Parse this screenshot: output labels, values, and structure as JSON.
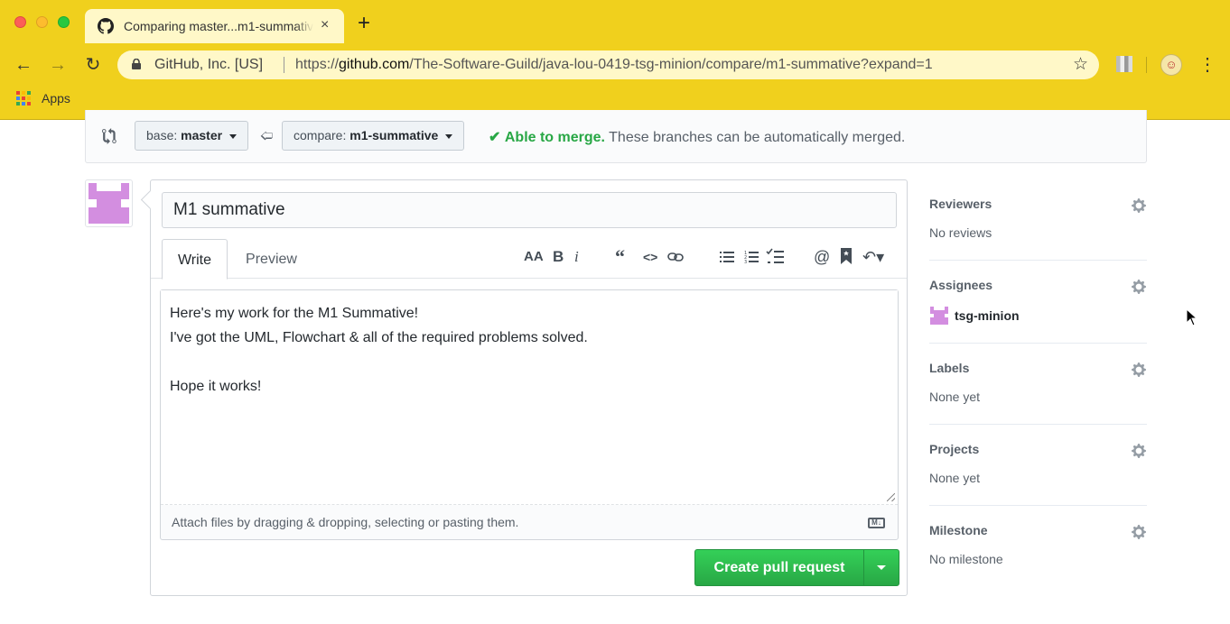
{
  "browser": {
    "tab_title": "Comparing master...m1-summative",
    "tab_close": "×",
    "new_tab": "+",
    "site_identity": "GitHub, Inc. [US]",
    "url_prefix": "https://",
    "url_host": "github.com",
    "url_path": "/The-Software-Guild/java-lou-0419-tsg-minion/compare/m1-summative?expand=1",
    "bookmarks": [
      {
        "label": "Apps"
      }
    ]
  },
  "branch_bar": {
    "base_label": "base:",
    "base_branch": "master",
    "compare_label": "compare:",
    "compare_branch": "m1-summative",
    "merge_status": "Able to merge.",
    "merge_message": "These branches can be automatically merged."
  },
  "form": {
    "title_value": "M1 summative",
    "tabs": [
      {
        "label": "Write"
      },
      {
        "label": "Preview"
      }
    ],
    "toolbar_icons": [
      "text-size-icon",
      "bold-icon",
      "italic-icon",
      "quote-icon",
      "code-icon",
      "link-icon",
      "unordered-list-icon",
      "ordered-list-icon",
      "task-list-icon",
      "mention-icon",
      "bookmark-icon",
      "reply-icon"
    ],
    "body_lines": [
      "Here's my work for the M1 Summative!",
      "I've got the UML, Flowchart & all of the required problems solved.",
      "",
      "Hope it works!"
    ],
    "attach_hint": "Attach files by dragging & dropping, selecting or pasting them.",
    "submit_label": "Create pull request"
  },
  "sidebar": {
    "reviewers": {
      "heading": "Reviewers",
      "value": "No reviews"
    },
    "assignees": {
      "heading": "Assignees",
      "user": "tsg-minion"
    },
    "labels": {
      "heading": "Labels",
      "value": "None yet"
    },
    "projects": {
      "heading": "Projects",
      "value": "None yet"
    },
    "milestone": {
      "heading": "Milestone",
      "value": "No milestone"
    }
  },
  "colors": {
    "chrome": "#f0d01d",
    "success": "#28a745",
    "avatar_pink": "#d38ee0"
  }
}
